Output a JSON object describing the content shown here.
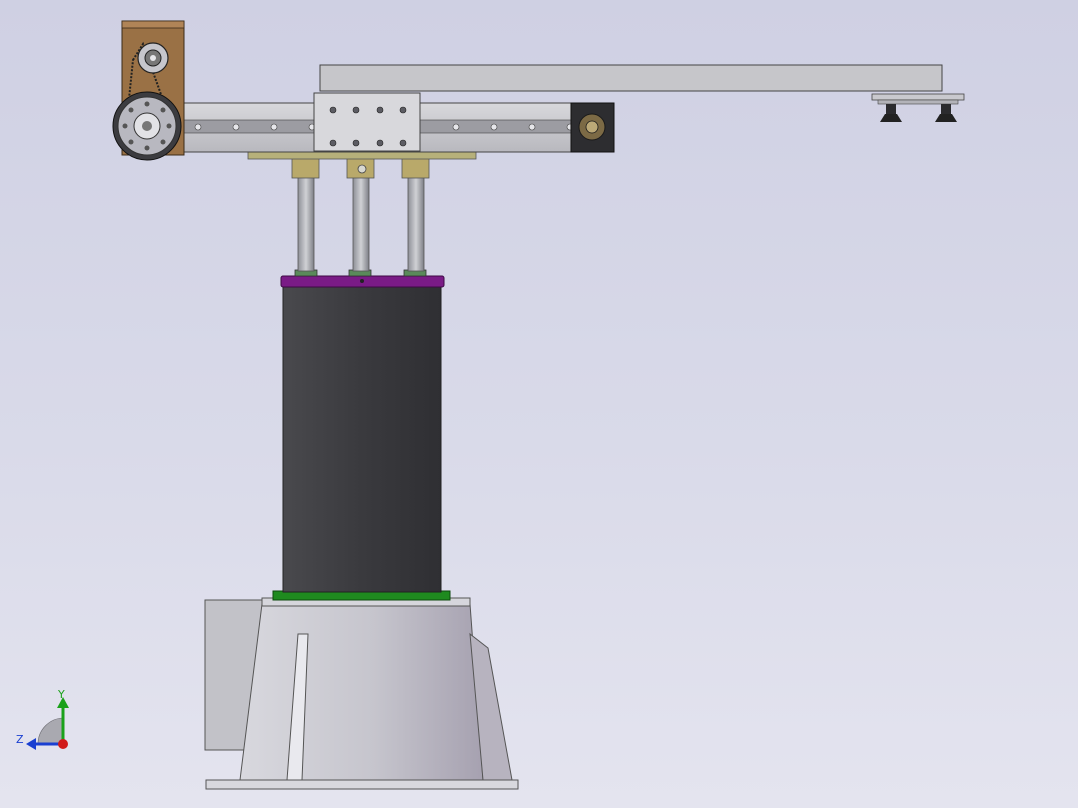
{
  "viewport": {
    "background_top": "#cfd0e3",
    "background_bottom": "#e4e4ef"
  },
  "model": {
    "name": "palletizing-robot-assembly",
    "parts": [
      "base-pedestal",
      "main-column",
      "guide-rods",
      "slide-rail",
      "arm-beam",
      "belt-pulley-drive",
      "end-effector-suction-cups"
    ],
    "colors": {
      "column": "#3a3a3e",
      "top-flange": "#7a1b86",
      "bottom-flange": "#1f8a1f",
      "pulley-plate": "#9a7145",
      "base": "#c4c3cb",
      "rail": "#c8c8cc",
      "rod-bushing": "#b9a96a"
    }
  },
  "triad": {
    "y_label": "Y",
    "z_label": "Z",
    "y_color": "#1aa11a",
    "z_color": "#1a3fd1",
    "x_color": "#d11a1a"
  }
}
